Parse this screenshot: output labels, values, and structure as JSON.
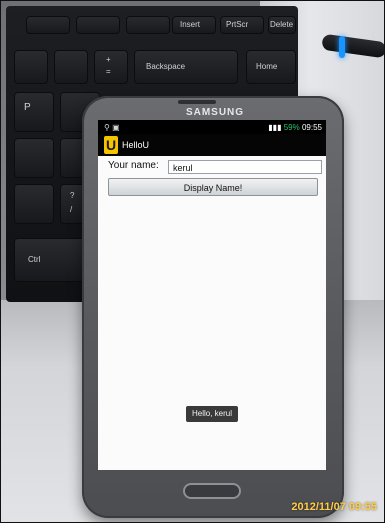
{
  "laptop": {
    "keys": [
      "Insert",
      "PrtScr",
      "Delete",
      "Backspace",
      "Home",
      "Ctrl",
      "P",
      "+",
      "?",
      "/",
      "="
    ]
  },
  "phone": {
    "brand": "SAMSUNG",
    "status_time": "09:55",
    "battery": "59%",
    "app": {
      "icon_letter": "U",
      "title": "HelloU",
      "name_label": "Your name:",
      "name_value": "kerul",
      "button_label": "Display Name!",
      "toast": "Hello, kerul"
    }
  },
  "photo_timestamp": "2012/11/07 09:55",
  "colors": {
    "app_icon": "#f5c400",
    "cable_led": "#1a94ff",
    "timestamp": "#ffcc44",
    "battery": "#29c26a"
  }
}
